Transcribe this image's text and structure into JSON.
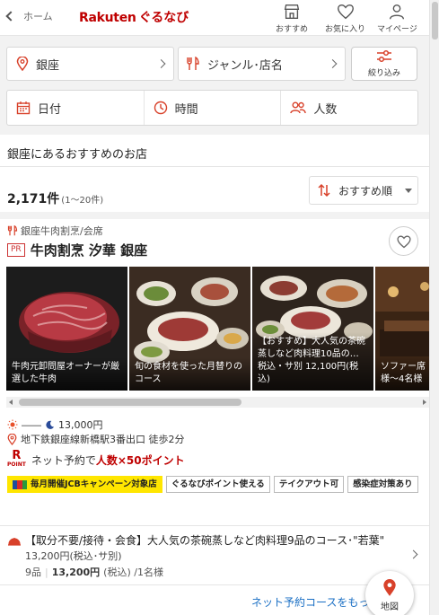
{
  "header": {
    "back_label": "ホーム",
    "logo_rakuten": "Rakuten",
    "logo_gurunavi": "ぐるなび",
    "nav": [
      {
        "label": "おすすめ",
        "icon": "store-icon"
      },
      {
        "label": "お気に入り",
        "icon": "heart-icon"
      },
      {
        "label": "マイページ",
        "icon": "person-icon"
      }
    ]
  },
  "search": {
    "area": "銀座",
    "genre": "ジャンル･店名",
    "filter_label": "絞り込み",
    "date": "日付",
    "time": "時間",
    "people": "人数"
  },
  "list": {
    "section_title": "銀座にあるおすすめのお店",
    "count": "2,171件",
    "range": "(1～20件)",
    "sort_label": "おすすめ順"
  },
  "restaurant": {
    "category": "銀座牛肉割烹/会席",
    "pr_badge": "PR",
    "name": "牛肉割烹 汐華 銀座",
    "photos": [
      {
        "caption": "牛肉元卸問屋オーナーが厳選した牛肉"
      },
      {
        "caption": "旬の食材を使った月替りのコース"
      },
      {
        "caption": "【おすすめ】大人気の茶碗蒸しなど肉料理10品の…\n税込・サ別 12,100円(税込)"
      },
      {
        "caption": "ソファー席様〜4名様"
      }
    ],
    "budget_lunch": "――",
    "budget_dinner": "13,000円",
    "access": "地下鉄銀座線新橋駅3番出口 徒歩2分",
    "point_text": "ネット予約で",
    "point_highlight": "人数×50ポイント",
    "point_logo_top": "R",
    "point_logo_bottom": "POINT",
    "tags": [
      "毎月開催JCBキャンペーン対象店",
      "ぐるなびポイント使える",
      "テイクアウト可",
      "感染症対策あり"
    ],
    "course_title": "【取分不要/接待・会食】大人気の茶碗蒸しなど肉料理9品のコース･\"若葉\"",
    "course_price": "13,200円(税込･サ別)",
    "course_items": "9品",
    "course_price_bold": "13,200円",
    "course_price_suffix": "(税込) /1名様",
    "more_link": "ネット予約コースをもっと",
    "map_label": "地図"
  },
  "colors": {
    "brand": "#bf0000",
    "accent_orange": "#d8412a",
    "link": "#1a6fc4",
    "jcb_yellow": "#ffe600"
  }
}
